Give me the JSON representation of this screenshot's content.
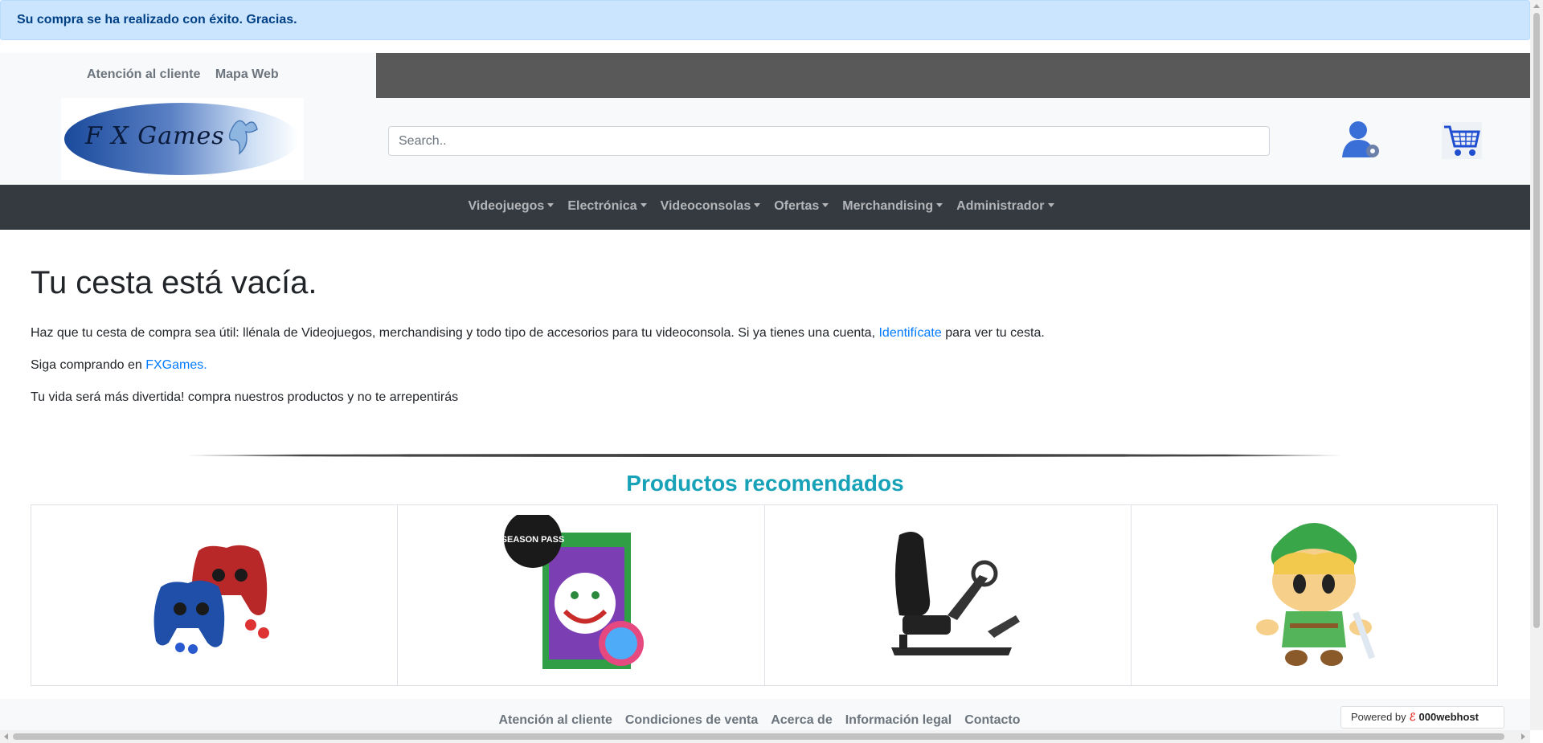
{
  "alert": {
    "message": "Su compra se ha realizado con éxito. Gracias."
  },
  "top_links": [
    "Atención al cliente",
    "Mapa Web"
  ],
  "logo": {
    "text": "F X Games"
  },
  "search": {
    "placeholder": "Search.."
  },
  "nav": {
    "items": [
      "Videojuegos",
      "Electrónica",
      "Videoconsolas",
      "Ofertas",
      "Merchandising",
      "Administrador"
    ]
  },
  "main": {
    "title": "Tu cesta está vacía.",
    "para1_before": "Haz que tu cesta de compra sea útil: llénala de Videojuegos, merchandising y todo tipo de accesorios para tu videoconsola. Si ya tienes una cuenta, ",
    "para1_link": "Identifícate",
    "para1_after": " para ver tu cesta.",
    "para2_before": "Siga comprando en ",
    "para2_link": "FXGames.",
    "para3": "Tu vida será más divertida! compra nuestros productos y no te arrepentirás"
  },
  "recommended": {
    "title": "Productos recomendados",
    "products": [
      {
        "name": "controller-skins-product-image"
      },
      {
        "name": "lego-dc-supervillains-product-image"
      },
      {
        "name": "racing-seat-product-image"
      },
      {
        "name": "link-plush-product-image"
      }
    ]
  },
  "product_image_text": {
    "season_pass_badge": "SEASON PASS"
  },
  "footer": {
    "links": [
      "Atención al cliente",
      "Condiciones de venta",
      "Acerca de",
      "Información legal",
      "Contacto"
    ]
  },
  "powered": {
    "label": "Powered by",
    "brand": "000webhost"
  },
  "colors": {
    "alert_bg": "#cce5ff",
    "nav_bg": "#343a40",
    "accent_teal": "#17a2b8",
    "link_blue": "#007bff"
  }
}
